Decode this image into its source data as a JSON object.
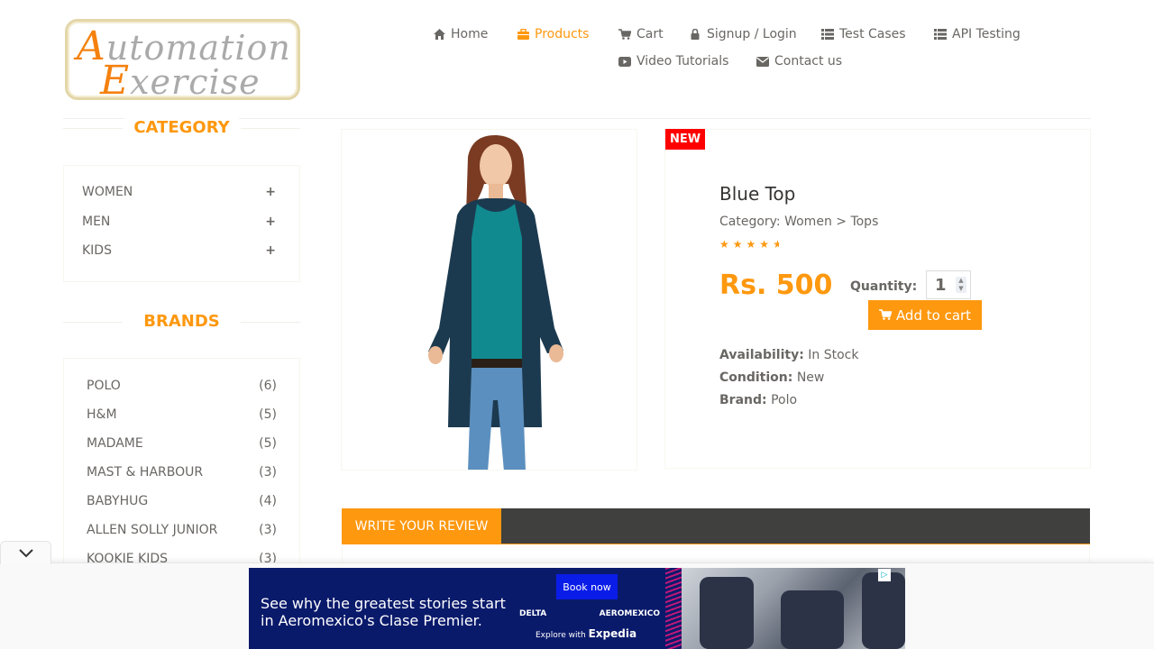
{
  "logo": {
    "line1_cap": "A",
    "line1_rest": "utomation",
    "line2_cap": "E",
    "line2_rest": "xercise"
  },
  "nav": {
    "home": "Home",
    "products": "Products",
    "cart": "Cart",
    "login": "Signup / Login",
    "test_cases": "Test Cases",
    "api_testing": "API Testing",
    "video_tutorials": "Video Tutorials",
    "contact_us": "Contact us"
  },
  "sidebar": {
    "category_title": "CATEGORY",
    "categories": [
      "WOMEN",
      "MEN",
      "KIDS"
    ],
    "brands_title": "BRANDS",
    "brands": [
      {
        "name": "POLO",
        "count": "(6)"
      },
      {
        "name": "H&M",
        "count": "(5)"
      },
      {
        "name": "MADAME",
        "count": "(5)"
      },
      {
        "name": "MAST & HARBOUR",
        "count": "(3)"
      },
      {
        "name": "BABYHUG",
        "count": "(4)"
      },
      {
        "name": "ALLEN SOLLY JUNIOR",
        "count": "(3)"
      },
      {
        "name": "KOOKIE KIDS",
        "count": "(3)"
      }
    ]
  },
  "product": {
    "badge": "NEW",
    "title": "Blue Top",
    "category": "Category: Women > Tops",
    "rating": 4.5,
    "price": "Rs. 500",
    "quantity_label": "Quantity:",
    "quantity_value": "1",
    "add_to_cart": "Add to cart",
    "availability_label": "Availability:",
    "availability": "In Stock",
    "condition_label": "Condition:",
    "condition": "New",
    "brand_label": "Brand:",
    "brand": "Polo"
  },
  "review": {
    "tab_label": "WRITE YOUR REVIEW"
  },
  "ad": {
    "headline": "See why the greatest stories start in Aeromexico's Clase Premier.",
    "cta": "Book now",
    "partner1": "DELTA",
    "partner2": "AEROMEXICO",
    "explore_prefix": "Explore with",
    "explore_brand": "Expedia"
  },
  "colors": {
    "accent": "#fe980f",
    "badge": "#ff0000",
    "review_bar": "#40403e",
    "ad_bg": "#0a1a6b"
  }
}
